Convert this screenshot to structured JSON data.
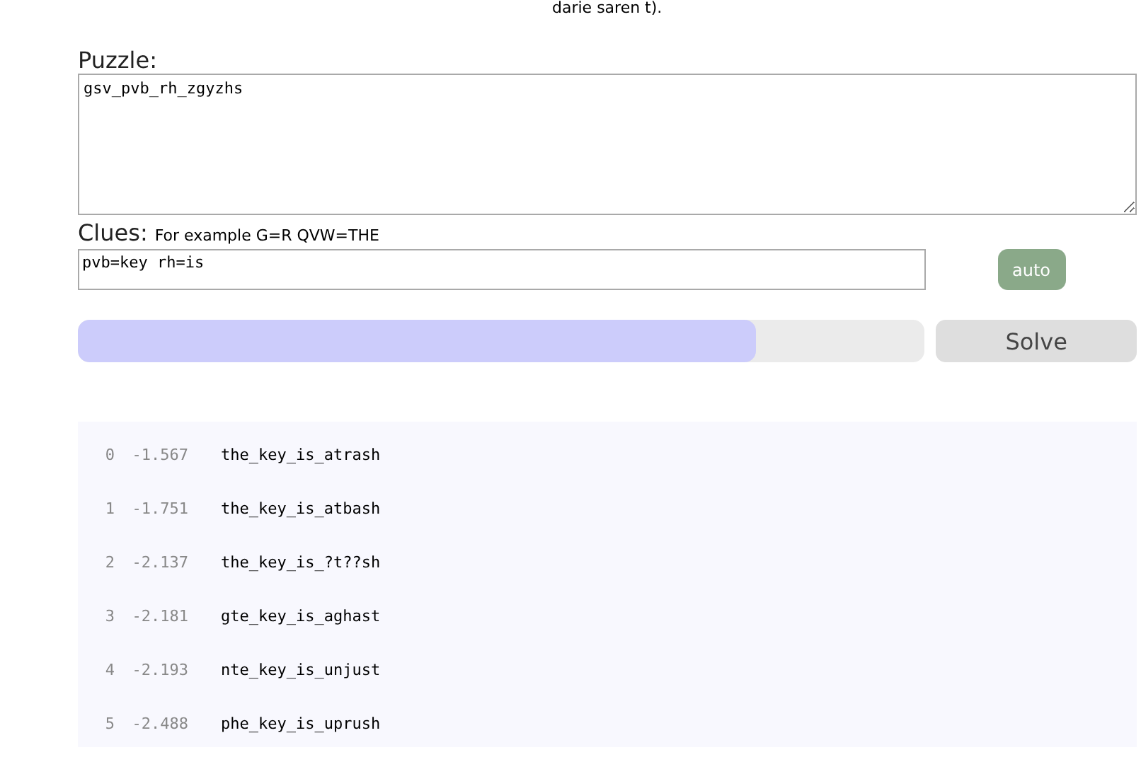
{
  "intro_tail": "darie saren t).",
  "puzzle": {
    "label": "Puzzle:",
    "value": "gsv_pvb_rh_zgyzhs"
  },
  "clues": {
    "label": "Clues:",
    "hint": "For example G=R QVW=THE",
    "value": "pvb=key rh=is"
  },
  "auto_button": "auto",
  "progress": {
    "level": 0.8
  },
  "solve_button": "Solve",
  "results": [
    {
      "index": "0",
      "score": "-1.567",
      "text": "the_key_is_atrash"
    },
    {
      "index": "1",
      "score": "-1.751",
      "text": "the_key_is_atbash"
    },
    {
      "index": "2",
      "score": "-2.137",
      "text": "the_key_is_?t??sh"
    },
    {
      "index": "3",
      "score": "-2.181",
      "text": "gte_key_is_aghast"
    },
    {
      "index": "4",
      "score": "-2.193",
      "text": "nte_key_is_unjust"
    },
    {
      "index": "5",
      "score": "-2.488",
      "text": "phe_key_is_uprush"
    }
  ]
}
